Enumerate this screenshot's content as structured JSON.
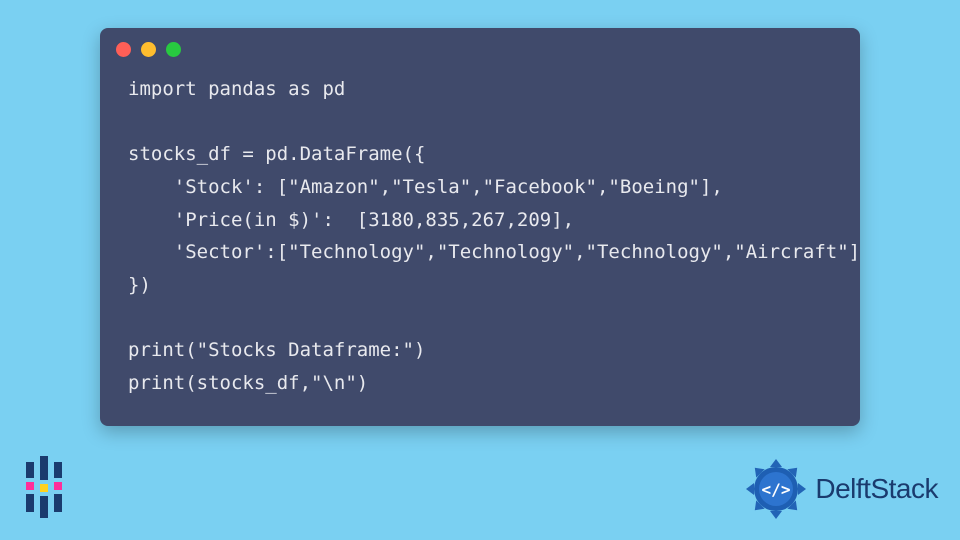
{
  "code": {
    "lines": [
      "import pandas as pd",
      "",
      "stocks_df = pd.DataFrame({",
      "    'Stock': [\"Amazon\",\"Tesla\",\"Facebook\",\"Boeing\"],",
      "    'Price(in $)':  [3180,835,267,209],",
      "    'Sector':[\"Technology\",\"Technology\",\"Technology\",\"Aircraft\"]",
      "})",
      "",
      "print(\"Stocks Dataframe:\")",
      "print(stocks_df,\"\\n\")"
    ]
  },
  "brand": {
    "name": "DelftStack"
  },
  "colors": {
    "background": "#7ad0f2",
    "window": "#404a6b",
    "text": "#e8e9ee",
    "brand": "#1a3b6e"
  }
}
